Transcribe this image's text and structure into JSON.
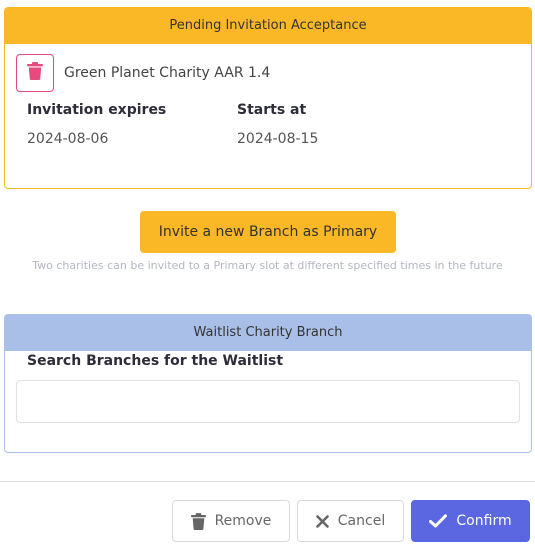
{
  "pending": {
    "header": "Pending Invitation Acceptance",
    "charity_name": "Green Planet Charity AAR 1.4",
    "expires_label": "Invitation expires",
    "expires_value": "2024-08-06",
    "starts_label": "Starts at",
    "starts_value": "2024-08-15"
  },
  "invite": {
    "button_label": "Invite a new Branch as Primary",
    "hint": "Two charities can be invited to a Primary slot at different specified times in the future"
  },
  "waitlist": {
    "header": "Waitlist Charity Branch",
    "search_label": "Search Branches for the Waitlist",
    "search_value": "",
    "search_placeholder": ""
  },
  "footer": {
    "remove_label": "Remove",
    "cancel_label": "Cancel",
    "confirm_label": "Confirm"
  },
  "colors": {
    "pending_accent": "#fbb826",
    "waitlist_accent": "#a9bfe8",
    "delete_pink": "#e74a7c",
    "confirm_blue": "#5a67e0"
  },
  "icons": {
    "charity_delete": "trash-icon",
    "remove": "trash-icon",
    "cancel": "close-icon",
    "confirm": "check-icon"
  }
}
